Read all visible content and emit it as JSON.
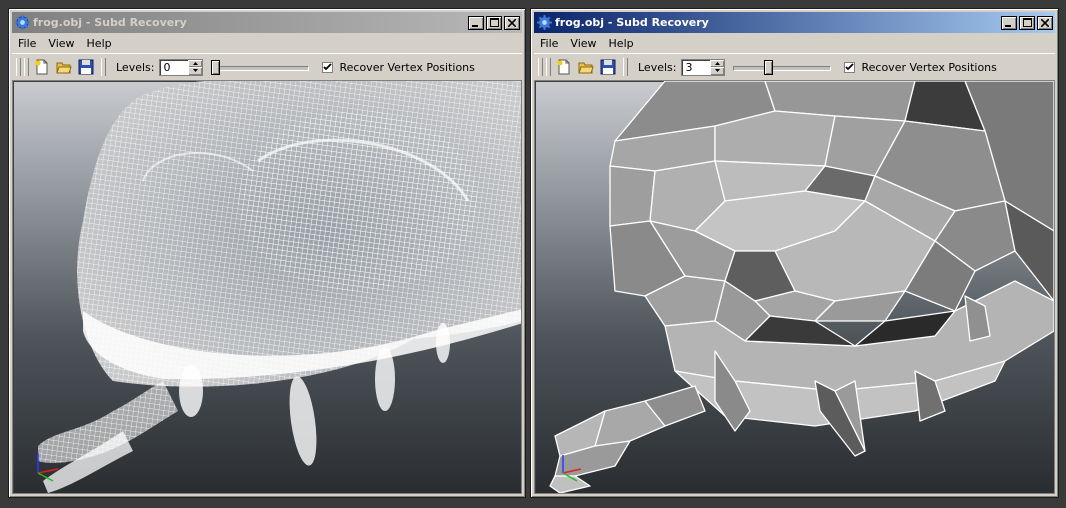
{
  "windows": [
    {
      "title": "frog.obj - Subd Recovery",
      "state": "inactive",
      "menu": [
        "File",
        "View",
        "Help"
      ],
      "levels_label": "Levels:",
      "levels_value": "0",
      "slider_fraction": 0.0,
      "checkbox_label": "Recover Vertex Positions",
      "checkbox_checked": true,
      "view_mode": "dense wireframe"
    },
    {
      "title": "frog.obj - Subd Recovery",
      "state": "active",
      "menu": [
        "File",
        "View",
        "Help"
      ],
      "levels_label": "Levels:",
      "levels_value": "3",
      "slider_fraction": 0.35,
      "checkbox_label": "Recover Vertex Positions",
      "checkbox_checked": true,
      "view_mode": "low-poly shaded"
    }
  ],
  "icons": {
    "app": "app-gear-icon",
    "new": "new-file-icon",
    "open": "open-folder-icon",
    "save": "save-disk-icon",
    "axis": "axis-gizmo-icon"
  },
  "colors": {
    "active_title_start": "#0a246a",
    "active_title_end": "#a6caf0",
    "inactive_title_start": "#808080",
    "wireframe": "#ffffff",
    "mesh_fill": "#9a9a9a"
  }
}
